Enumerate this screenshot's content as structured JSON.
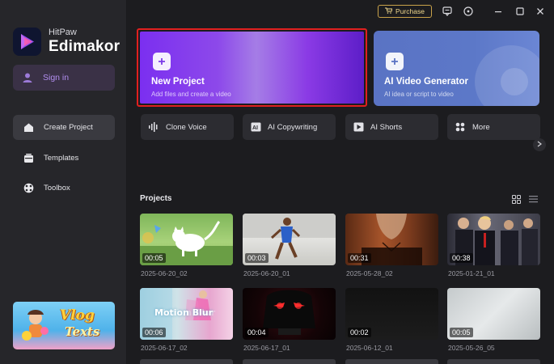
{
  "app": {
    "brand_small": "HitPaw",
    "brand_big": "Edimakor"
  },
  "sidebar": {
    "signin_label": "Sign in",
    "items": [
      {
        "label": "Create Project",
        "icon": "home-icon",
        "active": true
      },
      {
        "label": "Templates",
        "icon": "templates-icon",
        "active": false
      },
      {
        "label": "Toolbox",
        "icon": "toolbox-icon",
        "active": false
      }
    ],
    "promo": {
      "line1": "Vlog",
      "line2": "Texts"
    }
  },
  "topbar": {
    "purchase_label": "Purchase"
  },
  "hero": {
    "new_project": {
      "title": "New Project",
      "subtitle": "Add files and create a video"
    },
    "ai_video": {
      "title": "AI Video Generator",
      "subtitle": "AI idea or script to video"
    }
  },
  "tools": [
    {
      "label": "Clone Voice",
      "icon": "waveform-icon"
    },
    {
      "label": "AI Copywriting",
      "icon": "copywriting-icon"
    },
    {
      "label": "AI Shorts",
      "icon": "shorts-icon"
    },
    {
      "label": "More",
      "icon": "grid-dots-icon"
    }
  ],
  "projects": {
    "title": "Projects",
    "items": [
      {
        "duration": "00:05",
        "date": "2025-06-20_02"
      },
      {
        "duration": "00:03",
        "date": "2025-06-20_01"
      },
      {
        "duration": "00:31",
        "date": "2025-05-28_02"
      },
      {
        "duration": "00:38",
        "date": "2025-01-21_01"
      },
      {
        "duration": "00:06",
        "date": "2025-06-17_02"
      },
      {
        "duration": "00:04",
        "date": "2025-06-17_01"
      },
      {
        "duration": "00:02",
        "date": "2025-06-12_01"
      },
      {
        "duration": "00:05",
        "date": "2025-05-26_05"
      }
    ],
    "thumb_overlays": {
      "motion_blur": "Motion Blur"
    }
  },
  "colors": {
    "accent": "#8a4cf0",
    "highlight_border": "#e0201f",
    "purchase_gold": "#c9a24a"
  }
}
